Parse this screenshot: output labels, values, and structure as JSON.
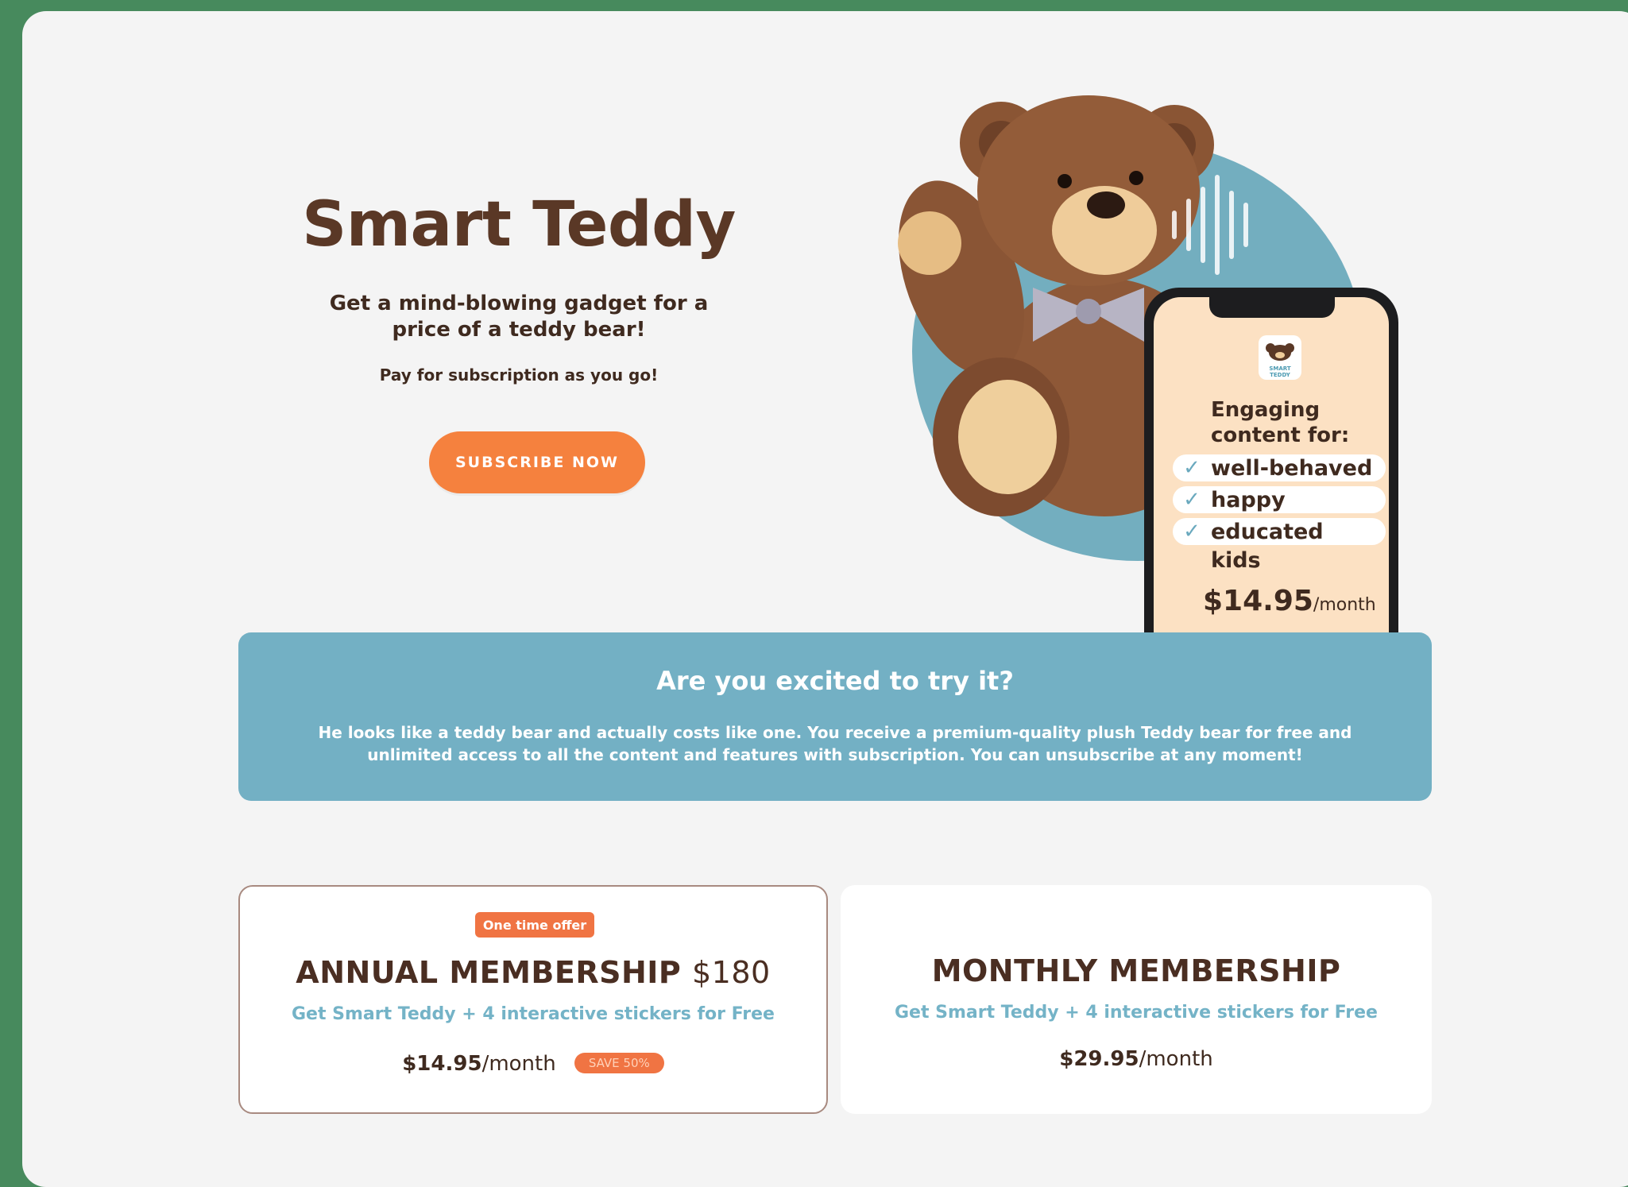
{
  "hero": {
    "title": "Smart Teddy",
    "subtitle_line1": "Get a mind-blowing gadget for a",
    "subtitle_line2": "price of a teddy bear!",
    "note": "Pay for subscription as you go!",
    "cta_label": "SUBSCRIBE NOW"
  },
  "phone": {
    "logo_text": "SMART TEDDY",
    "heading_line1": "Engaging",
    "heading_line2": "content for:",
    "items": [
      "well-behaved",
      "happy",
      "educated"
    ],
    "last_line": "kids",
    "price": "$14.95",
    "period": "/month"
  },
  "banner": {
    "title": "Are you excited to try it?",
    "text_line1": "He looks like a teddy bear and actually costs like one. You receive a premium-quality plush Teddy bear for free and",
    "text_line2": "unlimited access to all the content and features with subscription. You can unsubscribe at any moment!"
  },
  "plans": {
    "annual": {
      "badge": "One time offer",
      "title": "ANNUAL MEMBERSHIP",
      "title_price": "$180",
      "description": "Get Smart Teddy + 4 interactive stickers for Free",
      "price": "$14.95",
      "period": "/month",
      "save_badge": "SAVE 50%"
    },
    "monthly": {
      "title": "MONTHLY MEMBERSHIP",
      "description": "Get Smart Teddy + 4 interactive stickers for Free",
      "price": "$29.95",
      "period": "/month"
    }
  },
  "colors": {
    "background": "#478a5d",
    "panel": "#f4f4f4",
    "accent_orange": "#f5813e",
    "brand_blue": "#73b0c4",
    "brown_text": "#5a3826"
  }
}
